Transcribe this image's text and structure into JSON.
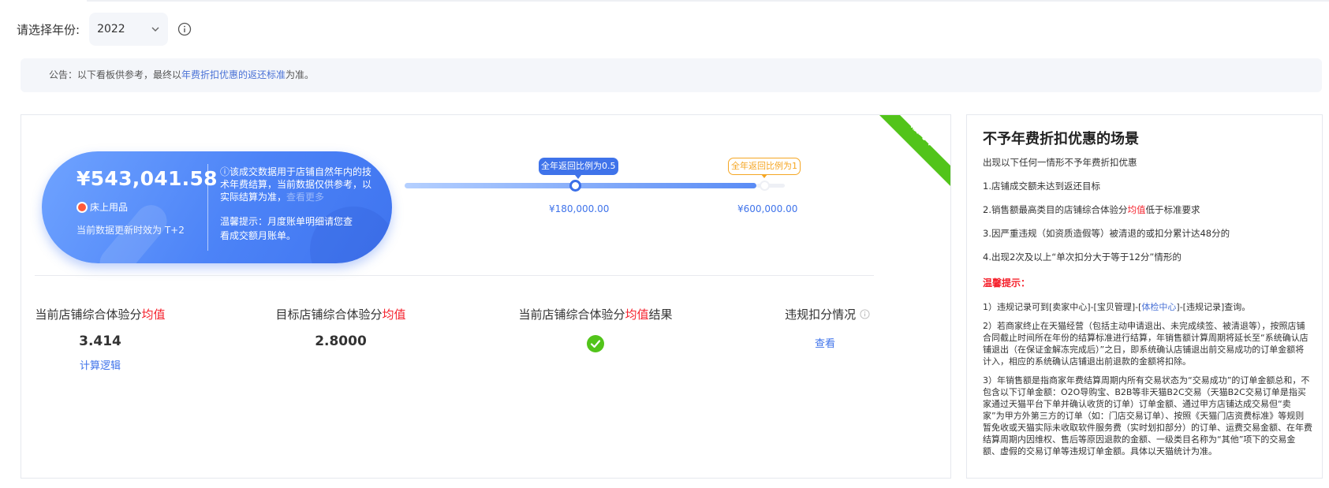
{
  "year_selector": {
    "label": "请选择年份:",
    "value": "2022"
  },
  "notice": {
    "prefix": "公告：以下看板供参考，最终以",
    "link": "年费折扣优惠的返还标准",
    "suffix": "为准。"
  },
  "status_ribbon": "履约中",
  "summary": {
    "amount": "¥543,041.58",
    "tag": "床上用品",
    "update": "当前数据更新时效为 T+2",
    "desc_main": "ⓘ该成交数据用于店铺自然年内的技术年费结算，当前数据仅供参考，以实际结算为准，",
    "desc_muted": "查看更多",
    "tip": "温馨提示：月度账单明细请您查看成交额月账单。"
  },
  "progress": {
    "fill_fraction": 0.905,
    "milestones": [
      {
        "bubble": "全年返回比例为0.5",
        "amount": "¥180,000.00",
        "reached": true
      },
      {
        "bubble": "全年返回比例为1",
        "amount": "¥600,000.00",
        "reached": false
      }
    ]
  },
  "metrics": {
    "current": {
      "prefix": "当前店铺综合体验分",
      "highlight": "均值",
      "suffix": "",
      "value": "3.414",
      "link": "计算逻辑"
    },
    "target": {
      "prefix": "目标店铺综合体验分",
      "highlight": "均值",
      "suffix": "",
      "value": "2.8000"
    },
    "result": {
      "prefix": "当前店铺综合体验分",
      "highlight": "均值",
      "suffix": "结果",
      "status": "pass"
    },
    "violation": {
      "title": "违规扣分情况",
      "link": "查看"
    }
  },
  "right_panel": {
    "title": "不予年费折扣优惠的场景",
    "subtitle": "出现以下任何一情形不予年费折扣优惠",
    "items": [
      {
        "pre": "1.店铺成交额未达到返还目标",
        "hl": "",
        "post": ""
      },
      {
        "pre": "2.销售额最高类目的店铺综合体验分",
        "hl": "均值",
        "post": "低于标准要求"
      },
      {
        "pre": "3.因严重违规（如资质造假等）被清退的或扣分累计达48分的",
        "hl": "",
        "post": ""
      },
      {
        "pre": "4.出现2次及以上“单次扣分大于等于12分”情形的",
        "hl": "",
        "post": ""
      }
    ],
    "warm_title": "温馨提示：",
    "para1_pre": "1）违规记录可到[卖家中心]-[宝贝管理]-[",
    "para1_link": "体检中心",
    "para1_post": "]-[违规记录]查询。",
    "para2": "2）若商家终止在天猫经营（包括主动申请退出、未完成续签、被清退等），按照店铺合同截止时间所在年份的结算标准进行结算，年销售额计算周期将延长至“系统确认店铺退出（在保证金解冻完成后）”之日，即系统确认店铺退出前交易成功的订单金额将计入，相应的系统确认店铺退出前退款的金额将扣除。",
    "para3": "3）年销售额是指商家年费结算周期内所有交易状态为“交易成功”的订单金额总和，不包含以下订单金额：O2O导购宝、B2B等非天猫B2C交易（天猫B2C交易订单是指买家通过天猫平台下单并确认收货的订单）订单金额、通过甲方店铺达成交易但“卖家”为甲方外第三方的订单（如：门店交易订单）、按照《天猫门店资费标准》等规则暂免收或天猫实际未收取软件服务费（实时划扣部分）的订单、运费交易金额、在年费结算周期内因维权、售后等原因退款的金额、一级类目名称为“其他”项下的交易金额、虚假的交易订单等违规订单金额。具体以天猫统计为准。"
  },
  "colors": {
    "accent": "#3f73ea",
    "highlight_red": "#f5222d",
    "ribbon_green": "#52c41a",
    "milestone_orange": "#f5a623"
  }
}
